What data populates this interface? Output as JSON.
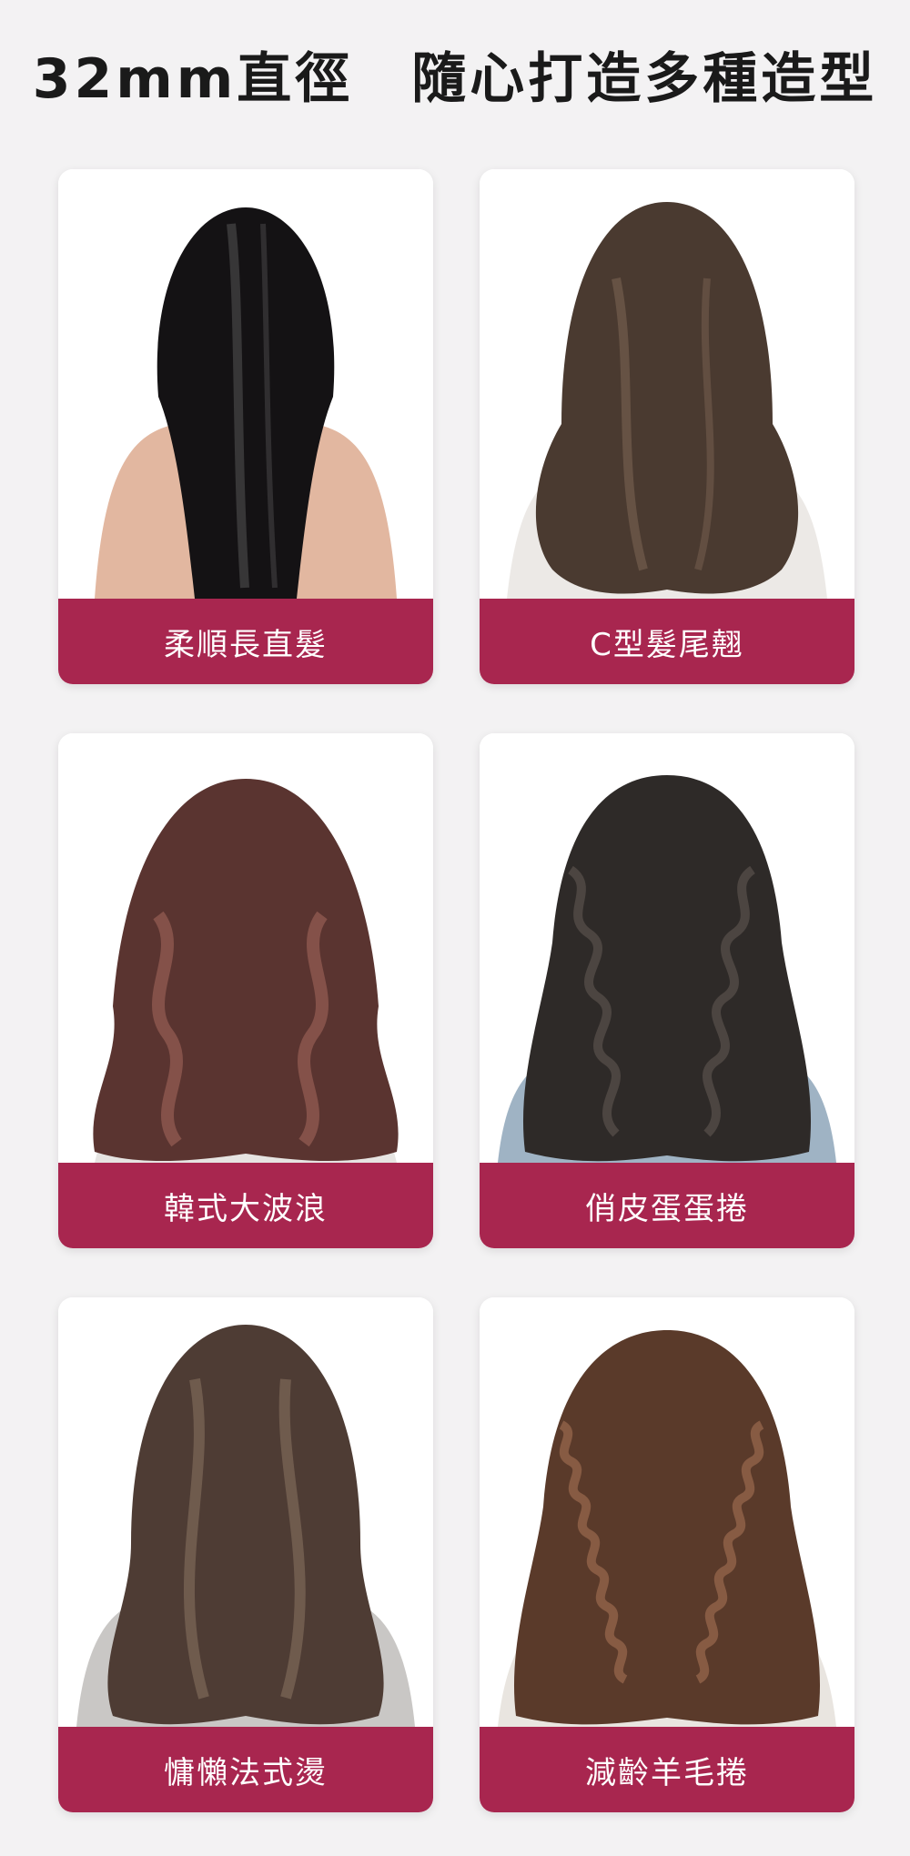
{
  "title": "32mm直徑　隨心打造多種造型",
  "colors": {
    "label_bar": "#a8264f",
    "background": "#f3f2f3"
  },
  "cards": [
    {
      "label": "柔順長直髮",
      "hair": "#141214",
      "highlight": "#5a5a5a",
      "style": "straight"
    },
    {
      "label": "C型髮尾翹",
      "hair": "#4a3a30",
      "highlight": "#7a6252",
      "style": "c-curl"
    },
    {
      "label": "韓式大波浪",
      "hair": "#5a3430",
      "highlight": "#a0665a",
      "style": "big-wave"
    },
    {
      "label": "俏皮蛋蛋捲",
      "hair": "#2e2a28",
      "highlight": "#5a514c",
      "style": "egg-roll"
    },
    {
      "label": "慵懶法式燙",
      "hair": "#4e3c34",
      "highlight": "#85705f",
      "style": "french"
    },
    {
      "label": "減齡羊毛捲",
      "hair": "#5a3a2a",
      "highlight": "#9a6a4e",
      "style": "wool"
    }
  ]
}
